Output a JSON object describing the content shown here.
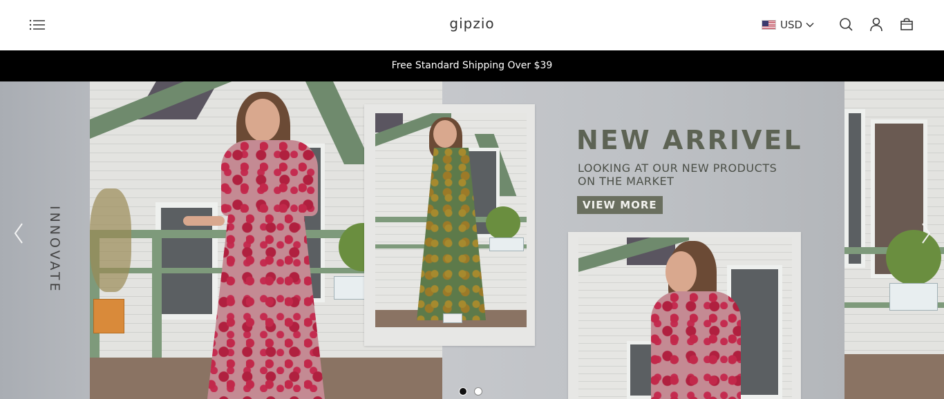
{
  "header": {
    "logo": "gipzio",
    "currency": "USD",
    "icons": [
      "menu-icon",
      "us-flag-icon",
      "chevron-down-icon",
      "search-icon",
      "account-icon",
      "cart-icon"
    ]
  },
  "announcement": {
    "text": "Free Standard Shipping Over $39"
  },
  "hero": {
    "headline": "NEW ARRIVEL",
    "subline_1": "LOOKING AT OUR NEW PRODUCTS",
    "subline_2": "ON THE MARKET",
    "cta": "VIEW MORE",
    "vertical_text": "INNOVATE",
    "slide_count": 2,
    "active_slide": 1
  },
  "colors": {
    "announcement_bg": "#000000",
    "headline": "#5d6354",
    "cta_bg": "#6a6f5f"
  }
}
